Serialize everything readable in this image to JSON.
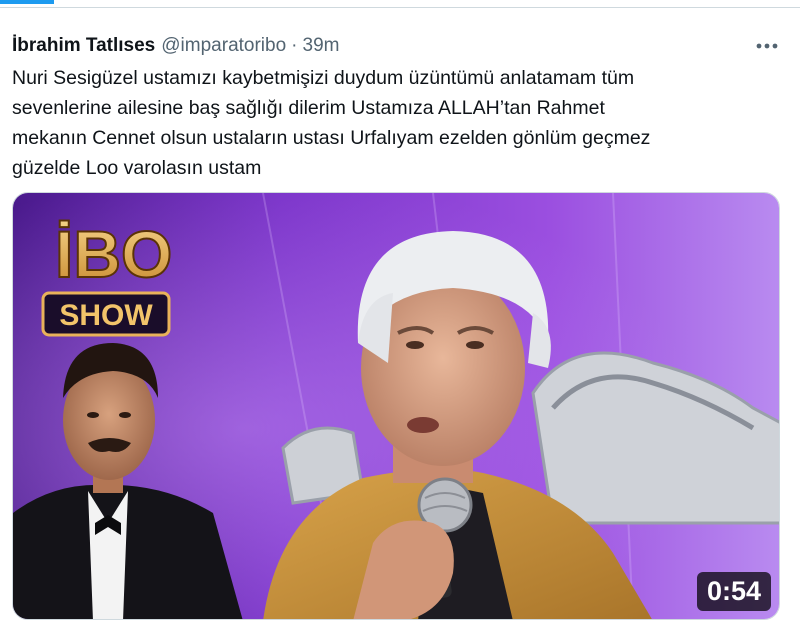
{
  "tweet": {
    "author_name": "İbrahim Tatlıses",
    "handle": "@imparatoribo",
    "separator": "·",
    "time": "39m",
    "text_lines": [
      "Nuri Sesigüzel ustamızı kaybetmişizi duydum üzüntümü anlatamam tüm",
      "sevenlerine ailesine baş sağlığı dilerim Ustamıza ALLAH’tan Rahmet",
      "mekanın Cennet olsun ustaların ustası Urfalıyam ezelden gönlüm geçmez",
      "güzelde Loo varolasın ustam"
    ],
    "more_icon": "more-horizontal-icon"
  },
  "media": {
    "type": "video",
    "logo_top": "İBO",
    "logo_bottom": "SHOW",
    "duration": "0:54"
  },
  "colors": {
    "accent": "#1d9bf0",
    "background_purple": "#8c3fd6",
    "logo_gold": "#e9b25a",
    "jacket": "#c9943a"
  }
}
